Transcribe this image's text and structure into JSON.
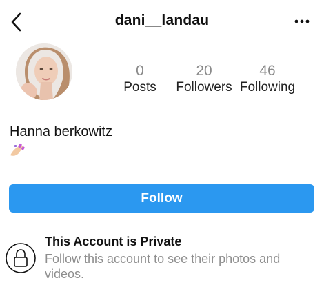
{
  "header": {
    "username": "dani__landau",
    "back_icon": "chevron-left-icon",
    "more_icon": "more-horizontal-icon"
  },
  "profile": {
    "avatar_icon": "profile-photo",
    "display_name": "Hanna berkowitz",
    "bio_emoji_icon": "nail-polish-emoji-icon"
  },
  "stats": {
    "posts": {
      "value": "0",
      "label": "Posts"
    },
    "followers": {
      "value": "20",
      "label": "Followers"
    },
    "following": {
      "value": "46",
      "label": "Following"
    }
  },
  "actions": {
    "follow_label": "Follow",
    "follow_color": "#2b98f0"
  },
  "privacy": {
    "lock_icon": "lock-icon",
    "title": "This Account is Private",
    "description": "Follow this account to see their photos and videos."
  }
}
